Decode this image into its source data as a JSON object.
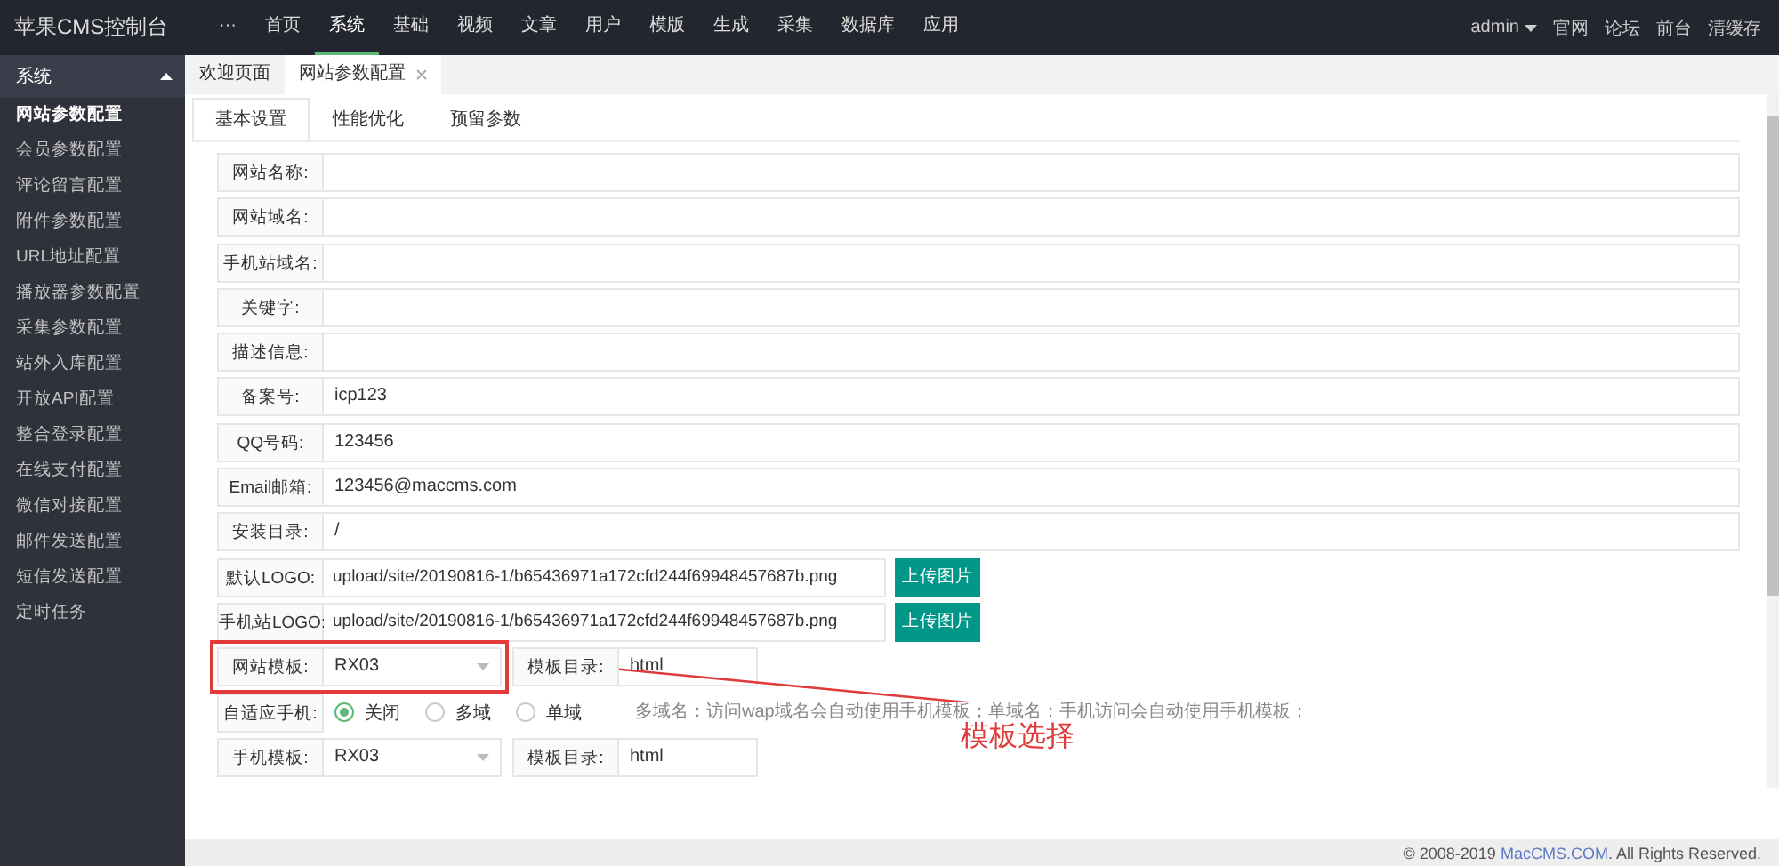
{
  "brand": "苹果CMS控制台",
  "top_nav": [
    {
      "label": "···",
      "selected": false
    },
    {
      "label": "首页",
      "selected": false
    },
    {
      "label": "系统",
      "selected": true
    },
    {
      "label": "基础",
      "selected": false
    },
    {
      "label": "视频",
      "selected": false
    },
    {
      "label": "文章",
      "selected": false
    },
    {
      "label": "用户",
      "selected": false
    },
    {
      "label": "模版",
      "selected": false
    },
    {
      "label": "生成",
      "selected": false
    },
    {
      "label": "采集",
      "selected": false
    },
    {
      "label": "数据库",
      "selected": false
    },
    {
      "label": "应用",
      "selected": false
    }
  ],
  "user_menu": {
    "label": "admin"
  },
  "top_links": [
    "官网",
    "论坛",
    "前台",
    "清缓存"
  ],
  "sidebar": {
    "group": {
      "label": "系统",
      "expanded": true
    },
    "items": [
      {
        "label": "网站参数配置",
        "selected": true
      },
      {
        "label": "会员参数配置",
        "selected": false
      },
      {
        "label": "评论留言配置",
        "selected": false
      },
      {
        "label": "附件参数配置",
        "selected": false
      },
      {
        "label": "URL地址配置",
        "selected": false
      },
      {
        "label": "播放器参数配置",
        "selected": false
      },
      {
        "label": "采集参数配置",
        "selected": false
      },
      {
        "label": "站外入库配置",
        "selected": false
      },
      {
        "label": "开放API配置",
        "selected": false
      },
      {
        "label": "整合登录配置",
        "selected": false
      },
      {
        "label": "在线支付配置",
        "selected": false
      },
      {
        "label": "微信对接配置",
        "selected": false
      },
      {
        "label": "邮件发送配置",
        "selected": false
      },
      {
        "label": "短信发送配置",
        "selected": false
      },
      {
        "label": "定时任务",
        "selected": false
      }
    ]
  },
  "page_tabs": [
    {
      "label": "欢迎页面",
      "selected": false,
      "closable": false
    },
    {
      "label": "网站参数配置",
      "selected": true,
      "closable": true
    }
  ],
  "sub_tabs": [
    {
      "label": "基本设置",
      "selected": true
    },
    {
      "label": "性能优化",
      "selected": false
    },
    {
      "label": "预留参数",
      "selected": false
    }
  ],
  "form": {
    "rows": [
      {
        "kind": "text",
        "label": "网站名称:"
      },
      {
        "kind": "text",
        "label": "网站域名:"
      },
      {
        "kind": "text",
        "label": "手机站域名:"
      },
      {
        "kind": "text",
        "label": "关键字:"
      },
      {
        "kind": "text",
        "label": "描述信息:"
      },
      {
        "kind": "text",
        "label": "备案号:",
        "value": "icp123"
      },
      {
        "kind": "text",
        "label": "QQ号码:",
        "value": "123456"
      },
      {
        "kind": "text",
        "label": "Email邮箱:",
        "value": "123456@maccms.com"
      },
      {
        "kind": "text",
        "label": "安装目录:",
        "value": "/"
      },
      {
        "kind": "upload",
        "label": "默认LOGO:",
        "value": "upload/site/20190816-1/b65436971a172cfd244f69948457687b.png",
        "button": "上传图片"
      },
      {
        "kind": "upload",
        "label": "手机站LOGO:",
        "value": "upload/site/20190816-1/b65436971a172cfd244f69948457687b.png",
        "button": "上传图片"
      },
      {
        "kind": "select_pair",
        "label": "网站模板:",
        "value": "RX03",
        "label_2": "模板目录:",
        "value_2": "html",
        "highlighted": true
      },
      {
        "kind": "radio",
        "label": "自适应手机:",
        "options": [
          {
            "label": "关闭",
            "selected": true
          },
          {
            "label": "多域",
            "selected": false
          },
          {
            "label": "单域",
            "selected": false
          }
        ],
        "hint": "多域名：访问wap域名会自动使用手机模板；单域名：手机访问会自动使用手机模板；"
      },
      {
        "kind": "select_pair",
        "label": "手机模板:",
        "value": "RX03",
        "label_2": "模板目录:",
        "value_2": "html",
        "highlighted": false
      }
    ]
  },
  "annotation": {
    "text": "模板选择"
  },
  "footer": {
    "prefix": "© 2008-2019 ",
    "link": "MacCMS.COM",
    "suffix": ". All Rights Reserved."
  }
}
